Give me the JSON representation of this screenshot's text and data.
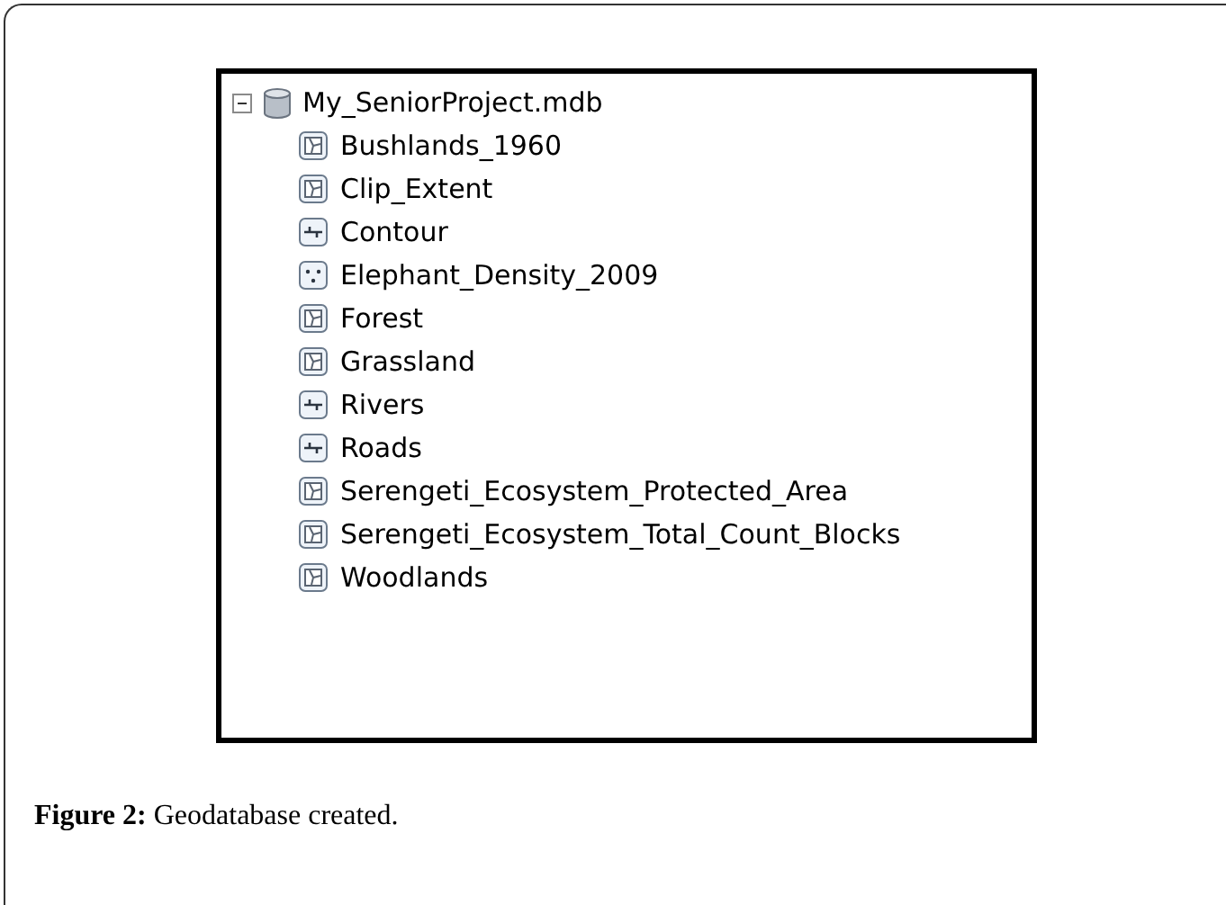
{
  "tree": {
    "label": "My_SeniorProject.mdb",
    "expanded": true,
    "children": [
      {
        "label": "Bushlands_1960",
        "kind": "polygon"
      },
      {
        "label": "Clip_Extent",
        "kind": "polygon"
      },
      {
        "label": "Contour",
        "kind": "line"
      },
      {
        "label": "Elephant_Density_2009",
        "kind": "point"
      },
      {
        "label": "Forest",
        "kind": "polygon"
      },
      {
        "label": "Grassland",
        "kind": "polygon"
      },
      {
        "label": "Rivers",
        "kind": "line"
      },
      {
        "label": "Roads",
        "kind": "line"
      },
      {
        "label": "Serengeti_Ecosystem_Protected_Area",
        "kind": "polygon"
      },
      {
        "label": "Serengeti_Ecosystem_Total_Count_Blocks",
        "kind": "polygon"
      },
      {
        "label": "Woodlands",
        "kind": "polygon"
      }
    ]
  },
  "caption": "**Figure 2:** Geodatabase created."
}
